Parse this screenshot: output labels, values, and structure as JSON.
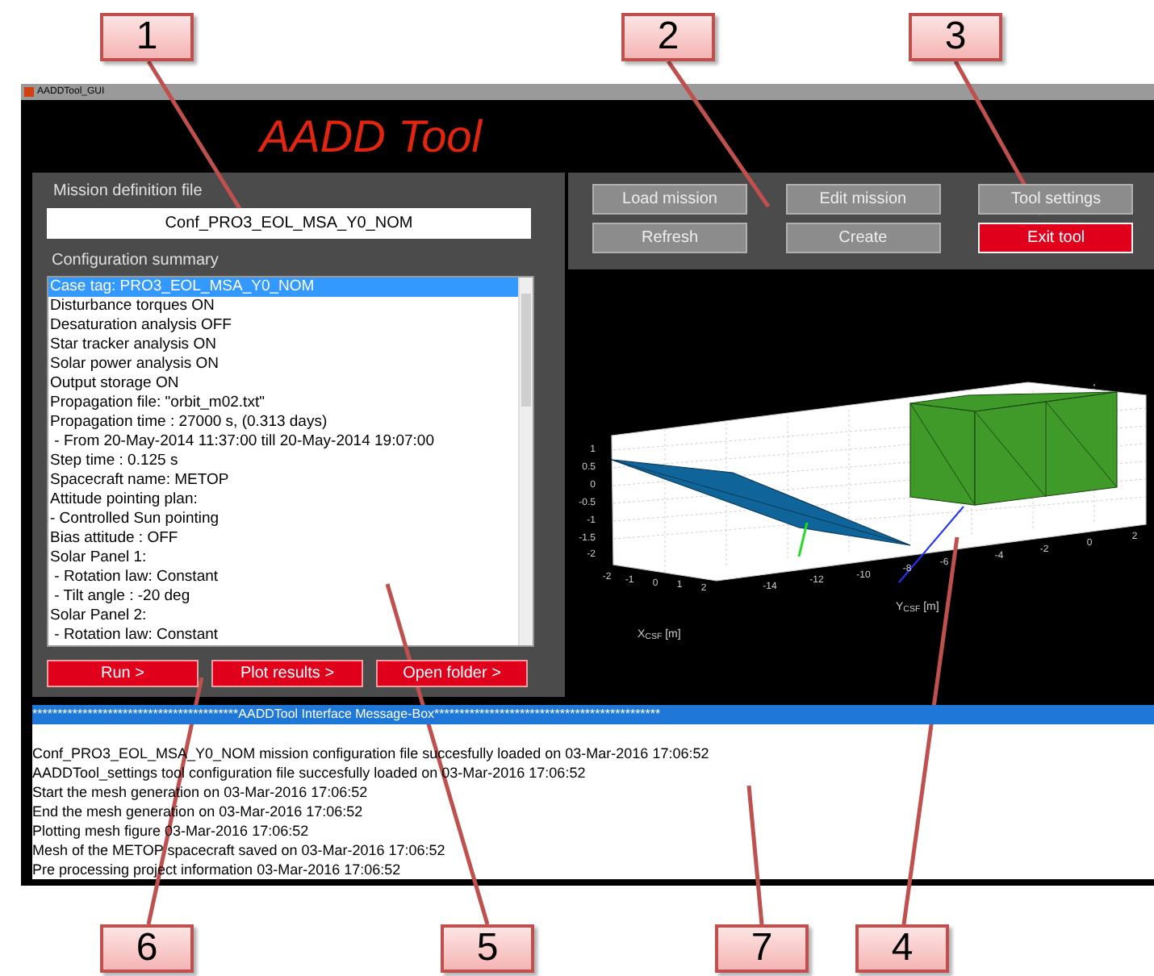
{
  "callouts": [
    "1",
    "2",
    "3",
    "6",
    "5",
    "7",
    "4"
  ],
  "window": {
    "title": "AADDTool_GUI"
  },
  "app_title": "AADD Tool",
  "mission_file": {
    "label": "Mission definition file",
    "value": "Conf_PRO3_EOL_MSA_Y0_NOM"
  },
  "config_summary": {
    "label": "Configuration summary",
    "items": [
      {
        "text": "Case tag: PRO3_EOL_MSA_Y0_NOM",
        "selected": true
      },
      {
        "text": "Disturbance torques ON",
        "selected": false
      },
      {
        "text": "Desaturation analysis OFF",
        "selected": false
      },
      {
        "text": "Star tracker analysis ON",
        "selected": false
      },
      {
        "text": "Solar power analysis ON",
        "selected": false
      },
      {
        "text": "Output storage ON",
        "selected": false
      },
      {
        "text": "Propagation file: \"orbit_m02.txt\"",
        "selected": false
      },
      {
        "text": "Propagation time : 27000 s, (0.313 days)",
        "selected": false
      },
      {
        "text": " - From 20-May-2014 11:37:00 till 20-May-2014 19:07:00",
        "selected": false
      },
      {
        "text": "Step time : 0.125 s",
        "selected": false
      },
      {
        "text": "Spacecraft name: METOP",
        "selected": false
      },
      {
        "text": "Attitude pointing plan:",
        "selected": false
      },
      {
        "text": "- Controlled Sun pointing",
        "selected": false
      },
      {
        "text": "Bias attitude : OFF",
        "selected": false
      },
      {
        "text": "Solar Panel 1:",
        "selected": false
      },
      {
        "text": " - Rotation law: Constant",
        "selected": false
      },
      {
        "text": " - Tilt angle : -20 deg",
        "selected": false
      },
      {
        "text": "Solar Panel 2:",
        "selected": false
      },
      {
        "text": " - Rotation law: Constant",
        "selected": false
      }
    ]
  },
  "left_buttons": [
    "Run >",
    "Plot results >",
    "Open folder >"
  ],
  "top_buttons": [
    {
      "label": "Load mission",
      "kind": "normal"
    },
    {
      "label": "Edit mission",
      "kind": "normal"
    },
    {
      "label": "Tool settings",
      "kind": "normal"
    },
    {
      "label": "Refresh",
      "kind": "normal"
    },
    {
      "label": "Create",
      "kind": "normal"
    },
    {
      "label": "Exit tool",
      "kind": "danger"
    }
  ],
  "plot": {
    "z_ticks": [
      "1",
      "0.5",
      "0",
      "-0.5",
      "-1",
      "-1.5",
      "-2"
    ],
    "x_ticks": [
      "-2",
      "-1",
      "0",
      "1",
      "2"
    ],
    "y_ticks": [
      "-14",
      "-12",
      "-10",
      "-8",
      "-6",
      "-4",
      "-2",
      "0",
      "2"
    ],
    "x_label": "X$_{CSF}$ [m]",
    "y_label": "Y$_{CSF}$ [m]"
  },
  "message_box": {
    "header": "*****************************************AADDTool Interface Message-Box*********************************************",
    "lines": [
      "Conf_PRO3_EOL_MSA_Y0_NOM mission configuration file succesfully loaded on 03-Mar-2016 17:06:52",
      "AADDTool_settings tool configuration file succesfully loaded on 03-Mar-2016 17:06:52",
      "Start the mesh generation on 03-Mar-2016 17:06:52",
      "End the mesh generation on 03-Mar-2016 17:06:52",
      "Plotting mesh figure 03-Mar-2016 17:06:52",
      "Mesh of the METOP spacecraft saved on 03-Mar-2016 17:06:52",
      "Pre processing project information 03-Mar-2016 17:06:52"
    ]
  }
}
